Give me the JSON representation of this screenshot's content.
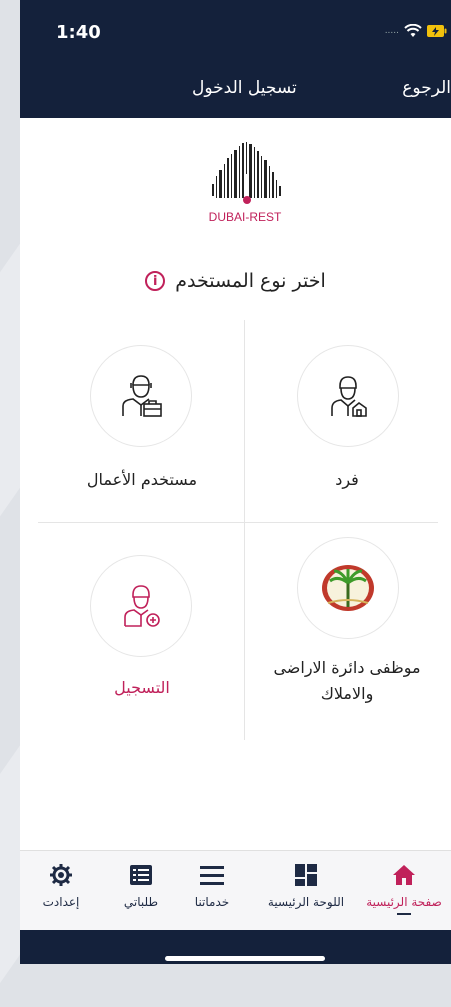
{
  "status_bar": {
    "time": "1:40",
    "carrier": "....."
  },
  "navbar": {
    "title": "تسجيل الدخول",
    "back_label": "الرجوع"
  },
  "logo": {
    "text": "DUBAI-REST"
  },
  "heading": {
    "text": "اختر نوع المستخدم",
    "info_symbol": "i"
  },
  "user_types": [
    {
      "label": "فرد",
      "icon": "individual-user-icon"
    },
    {
      "label": "مستخدم الأعمال",
      "icon": "business-user-icon"
    },
    {
      "label_line1": "موظفى دائرة الاراضى",
      "label_line2": "والاملاك",
      "icon": "land-department-palm-icon"
    },
    {
      "label": "التسجيل",
      "icon": "register-user-icon"
    }
  ],
  "tabs": [
    {
      "label": "صفحة الرئيسية",
      "icon": "home-icon",
      "active": true
    },
    {
      "label": "اللوحة الرئيسية",
      "icon": "dashboard-icon",
      "active": false
    },
    {
      "label": "خدماتنا",
      "icon": "menu-icon",
      "active": false
    },
    {
      "label": "طلباتي",
      "icon": "list-icon",
      "active": false
    },
    {
      "label": "إعدادت",
      "icon": "gear-icon",
      "active": false
    }
  ],
  "colors": {
    "navy": "#14213b",
    "accent": "#c0215a",
    "divider": "#e5e5e5"
  }
}
